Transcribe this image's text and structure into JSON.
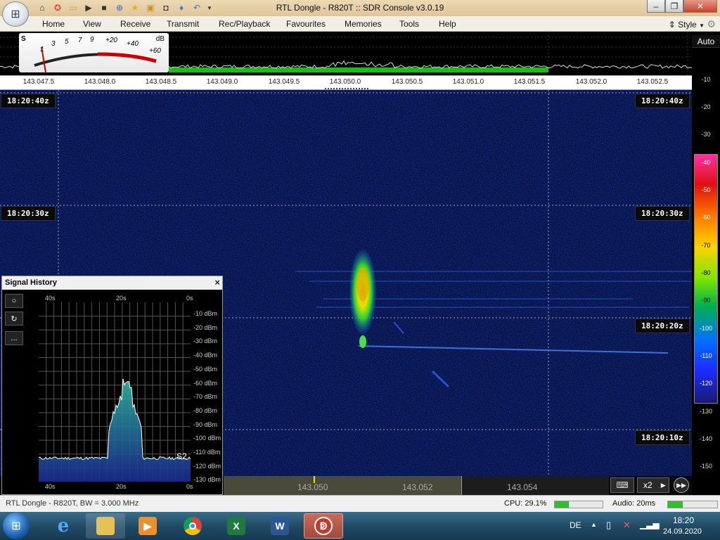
{
  "window": {
    "title": "RTL Dongle - R820T :: SDR Console v3.0.19",
    "minimize_icon": "minimize-icon",
    "maximize_icon": "restore-icon",
    "close_icon": "close-icon"
  },
  "quick_access": [
    "home-icon",
    "help-lifebuoy-icon",
    "folder-icon",
    "play-icon",
    "stop-icon",
    "add-icon",
    "star-icon",
    "lock-icon",
    "camera-icon",
    "drop-icon",
    "undo-icon",
    "dropdown-icon"
  ],
  "menu": {
    "items": [
      "Home",
      "View",
      "Receive",
      "Transmit",
      "Rec/Playback",
      "Favourites",
      "Memories",
      "Tools",
      "Help"
    ],
    "style_label": "Style"
  },
  "smeter": {
    "s_label": "S",
    "db_label": "dB",
    "scale": [
      "1",
      "3",
      "5",
      "7",
      "9",
      "+20",
      "+40",
      "+60"
    ]
  },
  "freq_scale": [
    "143.047.5",
    "143.048.0",
    "143.048.5",
    "143.049.0",
    "143.049.5",
    "143.050.0",
    "143.050.5",
    "143.051.0",
    "143.051.5",
    "143.052.0",
    "143.052.5"
  ],
  "waterfall": {
    "time_labels": [
      "18:20:40z",
      "18:20:30z",
      "18:20:20z",
      "18:20:10z"
    ]
  },
  "right_panel": {
    "auto_label": "Auto",
    "db_scale": [
      "-10",
      "-20",
      "-30",
      "-40",
      "-50",
      "-60",
      "-70",
      "-80",
      "-90",
      "-100",
      "-110",
      "-120",
      "-130",
      "-140",
      "-150"
    ],
    "colors": {
      "top": "#ff2fa2",
      "mid": "#7ce600",
      "low": "#0070ff",
      "bottom": "#1a1a70"
    }
  },
  "bottom_bar": {
    "freq_labels": [
      "143.050",
      "143.052",
      "143.054"
    ],
    "keyboard_icon": "keyboard-icon",
    "zoom_label": "x2",
    "arrow_icon": "arrow-right-icon",
    "forward_icon": "fast-forward-icon"
  },
  "signal_history": {
    "title": "Signal History",
    "close_label": "×",
    "buttons": [
      "record-icon",
      "refresh-icon",
      "more-icon"
    ],
    "more_label": "...",
    "top_time_labels": [
      "40s",
      "20s",
      "0s"
    ],
    "bottom_time_labels": [
      "40s",
      "20s",
      "0s"
    ],
    "dbm_labels": [
      "-10 dBm",
      "-20 dBm",
      "-30 dBm",
      "-40 dBm",
      "-50 dBm",
      "-60 dBm",
      "-70 dBm",
      "-80 dBm",
      "-90 dBm",
      "-100 dBm",
      "-110 dBm",
      "-120 dBm",
      "-130 dBm"
    ],
    "s_value": "S2"
  },
  "status": {
    "left": "RTL Dongle - R820T, BW = 3.000 MHz",
    "cpu_label": "CPU: 29.1%",
    "cpu_value": 29.1,
    "audio_label": "Audio: 20ms",
    "audio_fill": 0.3
  },
  "taskbar": {
    "apps": [
      "start-orb",
      "internet-explorer",
      "file-explorer",
      "media-player",
      "chrome",
      "excel",
      "word",
      "sdr-console"
    ],
    "lang": "DE",
    "time": "18:20",
    "date": "24.09.2020"
  }
}
